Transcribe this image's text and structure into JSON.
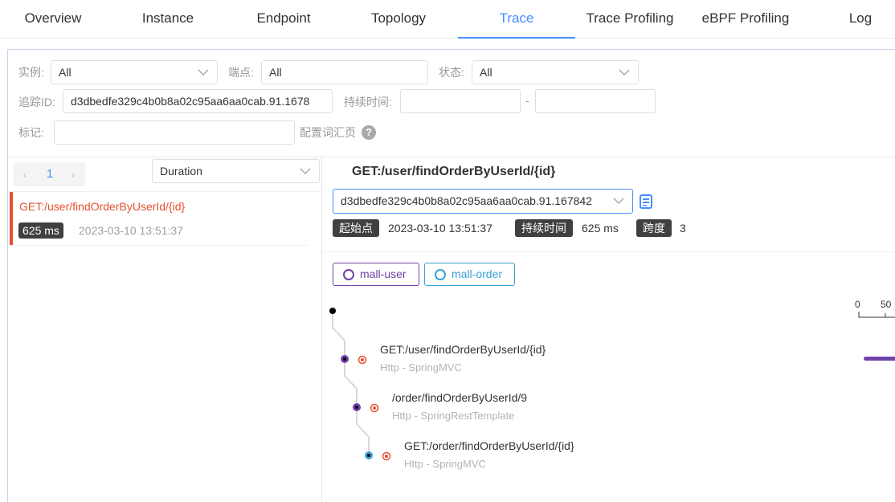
{
  "tabs": [
    "Overview",
    "Instance",
    "Endpoint",
    "Topology",
    "Trace",
    "Trace Profiling",
    "eBPF Profiling",
    "Log"
  ],
  "active_tab": "Trace",
  "filters": {
    "instance_label": "实例:",
    "instance_value": "All",
    "endpoint_label": "端点:",
    "endpoint_value": "All",
    "status_label": "状态:",
    "status_value": "All",
    "trace_id_label": "追踪ID:",
    "trace_id_value": "d3dbedfe329c4b0b8a02c95aa6aa0cab.91.1678",
    "duration_label": "持续时间:",
    "duration_min": "",
    "duration_max": "",
    "duration_sep": "-",
    "tags_label": "标记:",
    "tags_value": "",
    "tags_link": "配置词汇页",
    "help_glyph": "?"
  },
  "list": {
    "page": "1",
    "sort": "Duration",
    "items": [
      {
        "title": "GET:/user/findOrderByUserId/{id}",
        "duration": "625 ms",
        "time": "2023-03-10 13:51:37"
      }
    ]
  },
  "detail": {
    "title": "GET:/user/findOrderByUserId/{id}",
    "trace_select": "d3dbedfe329c4b0b8a02c95aa6aa0cab.91.167842",
    "start_label": "起始点",
    "start_value": "2023-03-10 13:51:37",
    "duration_label": "持续时间",
    "duration_value": "625 ms",
    "span_label": "跨度",
    "span_value": "3",
    "services": [
      {
        "name": "mall-user",
        "color": "#6f42a8"
      },
      {
        "name": "mall-order",
        "color": "#3aa0d6"
      }
    ],
    "axis_ticks": [
      "0",
      "50"
    ],
    "spans": [
      {
        "name": "GET:/user/findOrderByUserId/{id}",
        "type": "Http - SpringMVC"
      },
      {
        "name": "/order/findOrderByUserId/9",
        "type": "Http - SpringRestTemplate"
      },
      {
        "name": "GET:/order/findOrderByUserId/{id}",
        "type": "Http - SpringMVC"
      }
    ]
  },
  "colors": {
    "accent": "#448dfe",
    "error": "#e6502e",
    "mall_user": "#6f42a8",
    "mall_order": "#3aa0d6"
  }
}
